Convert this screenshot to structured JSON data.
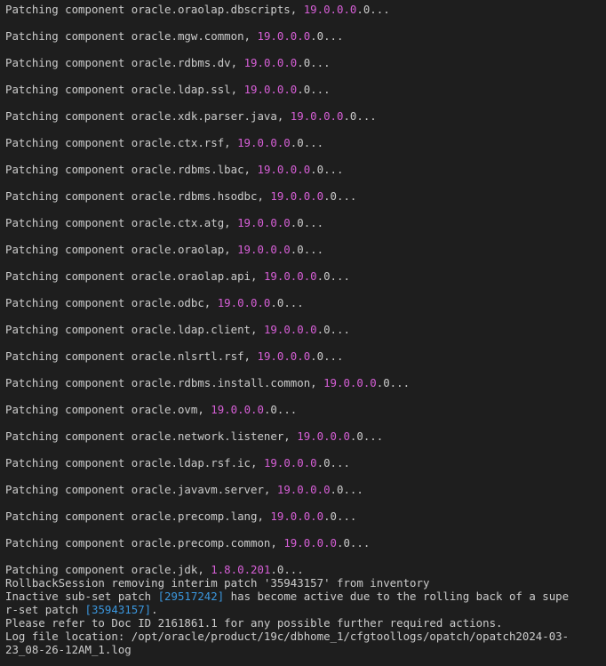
{
  "terminal": {
    "patching_lines": [
      {
        "prefix": "Patching component oracle.oraolap.dbscripts, ",
        "version": "19.0.0.0",
        "suffix": ".0..."
      },
      {
        "prefix": "Patching component oracle.mgw.common, ",
        "version": "19.0.0.0",
        "suffix": ".0..."
      },
      {
        "prefix": "Patching component oracle.rdbms.dv, ",
        "version": "19.0.0.0",
        "suffix": ".0..."
      },
      {
        "prefix": "Patching component oracle.ldap.ssl, ",
        "version": "19.0.0.0",
        "suffix": ".0..."
      },
      {
        "prefix": "Patching component oracle.xdk.parser.java, ",
        "version": "19.0.0.0",
        "suffix": ".0..."
      },
      {
        "prefix": "Patching component oracle.ctx.rsf, ",
        "version": "19.0.0.0",
        "suffix": ".0..."
      },
      {
        "prefix": "Patching component oracle.rdbms.lbac, ",
        "version": "19.0.0.0",
        "suffix": ".0..."
      },
      {
        "prefix": "Patching component oracle.rdbms.hsodbc, ",
        "version": "19.0.0.0",
        "suffix": ".0..."
      },
      {
        "prefix": "Patching component oracle.ctx.atg, ",
        "version": "19.0.0.0",
        "suffix": ".0..."
      },
      {
        "prefix": "Patching component oracle.oraolap, ",
        "version": "19.0.0.0",
        "suffix": ".0..."
      },
      {
        "prefix": "Patching component oracle.oraolap.api, ",
        "version": "19.0.0.0",
        "suffix": ".0..."
      },
      {
        "prefix": "Patching component oracle.odbc, ",
        "version": "19.0.0.0",
        "suffix": ".0..."
      },
      {
        "prefix": "Patching component oracle.ldap.client, ",
        "version": "19.0.0.0",
        "suffix": ".0..."
      },
      {
        "prefix": "Patching component oracle.nlsrtl.rsf, ",
        "version": "19.0.0.0",
        "suffix": ".0..."
      },
      {
        "prefix": "Patching component oracle.rdbms.install.common, ",
        "version": "19.0.0.0",
        "suffix": ".0..."
      },
      {
        "prefix": "Patching component oracle.ovm, ",
        "version": "19.0.0.0",
        "suffix": ".0..."
      },
      {
        "prefix": "Patching component oracle.network.listener, ",
        "version": "19.0.0.0",
        "suffix": ".0..."
      },
      {
        "prefix": "Patching component oracle.ldap.rsf.ic, ",
        "version": "19.0.0.0",
        "suffix": ".0..."
      },
      {
        "prefix": "Patching component oracle.javavm.server, ",
        "version": "19.0.0.0",
        "suffix": ".0..."
      },
      {
        "prefix": "Patching component oracle.precomp.lang, ",
        "version": "19.0.0.0",
        "suffix": ".0..."
      },
      {
        "prefix": "Patching component oracle.precomp.common, ",
        "version": "19.0.0.0",
        "suffix": ".0..."
      },
      {
        "prefix": "Patching component oracle.jdk, ",
        "version": "1.8.0.201",
        "suffix": ".0..."
      }
    ],
    "rollback_line": "RollbackSession removing interim patch '35943157' from inventory",
    "inactive_line": {
      "prefix": "Inactive sub-set patch ",
      "patch_id": "[29517242]",
      "suffix": " has become active due to the rolling back of a supe"
    },
    "superset_line": {
      "prefix": "r-set patch ",
      "patch_id": "[35943157]",
      "suffix": "."
    },
    "refer_line": "Please refer to Doc ID 2161861.1 for any possible further required actions.",
    "log_line_1": "Log file location: /opt/oracle/product/19c/dbhome_1/cfgtoollogs/opatch/opatch2024-03-",
    "log_line_2": "23_08-26-12AM_1.log",
    "colors": {
      "background": "#1e1e1e",
      "text": "#cccccc",
      "version": "#d75fd7",
      "patch_id": "#3a96dd"
    }
  }
}
